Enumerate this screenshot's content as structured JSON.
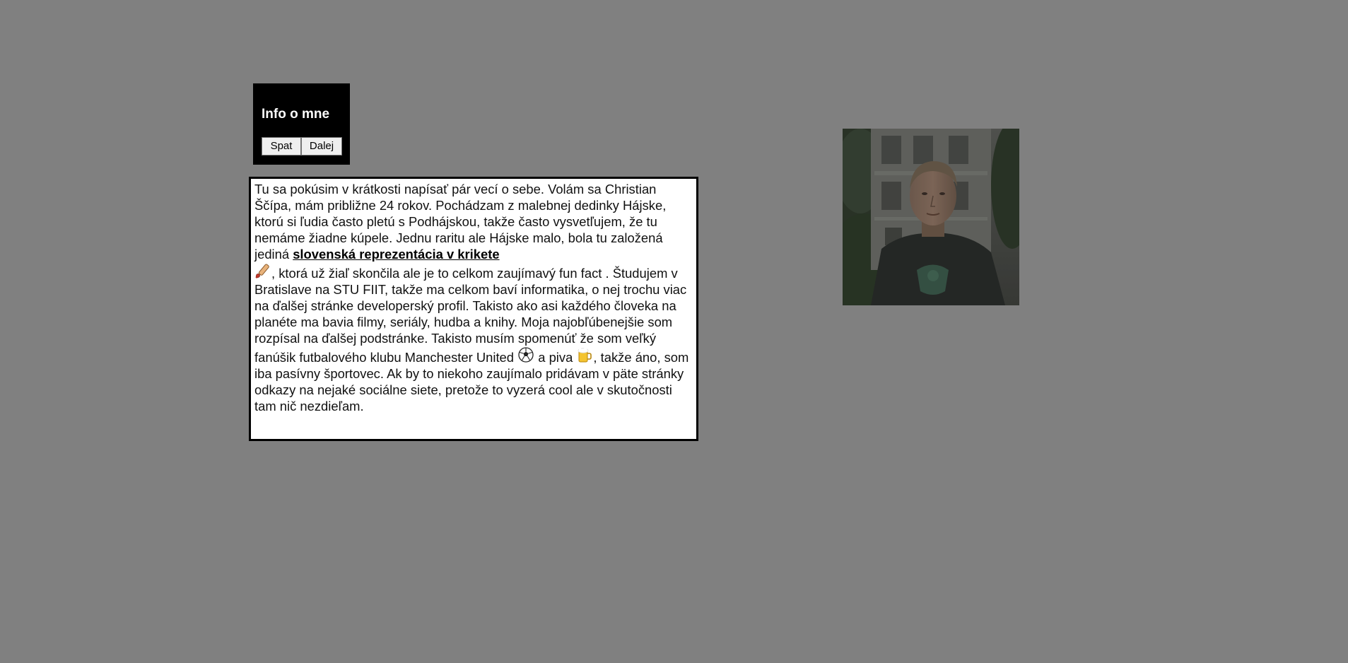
{
  "header": {
    "title": "Info o mne",
    "back_label": "Spat",
    "next_label": "Dalej"
  },
  "bio": {
    "part1": "Tu sa pokúsim v krátkosti napísať pár vecí o sebe. Volám sa Christian Ščípa, mám približne 24 rokov. Pochádzam z malebnej dedinky Hájske, ktorú si ľudia často pletú s Podhájskou, takže často vysvetľujem, že tu nemáme žiadne kúpele. Jednu raritu ale Hájske malo, bola tu založená jediná ",
    "link_text": "slovenská reprezentácia v krikete",
    "part2": ", ktorá už žiaľ skončila ale je to celkom zaujímavý fun fact . Študujem v Bratislave na STU FIIT, takže ma celkom baví informatika, o nej trochu viac na ďalšej stránke developerský profil. Takisto ako asi každého človeka na planéte ma bavia filmy, seriály, hudba a knihy. Moja najobľúbenejšie som rozpísal na ďalšej podstránke. Takisto musím spomenúť že som veľký fanúšik futbalového klubu Manchester United ",
    "part3": " a piva ",
    "part4": ", takže áno, som iba pasívny športovec. Ak by to niekoho zaujímalo pridávam v päte stránky odkazy na nejaké sociálne siete, pretože to vyzerá cool ale v skutočnosti tam nič nezdieľam.",
    "icons": [
      "cricket-icon",
      "soccer-ball-icon",
      "beer-icon"
    ]
  },
  "photo": {
    "subject": "portrait-photo"
  },
  "colors": {
    "background": "#808080",
    "header_bg": "#000000",
    "header_text": "#ffffff",
    "text_box_bg": "#ffffff",
    "text_box_border": "#000000"
  }
}
